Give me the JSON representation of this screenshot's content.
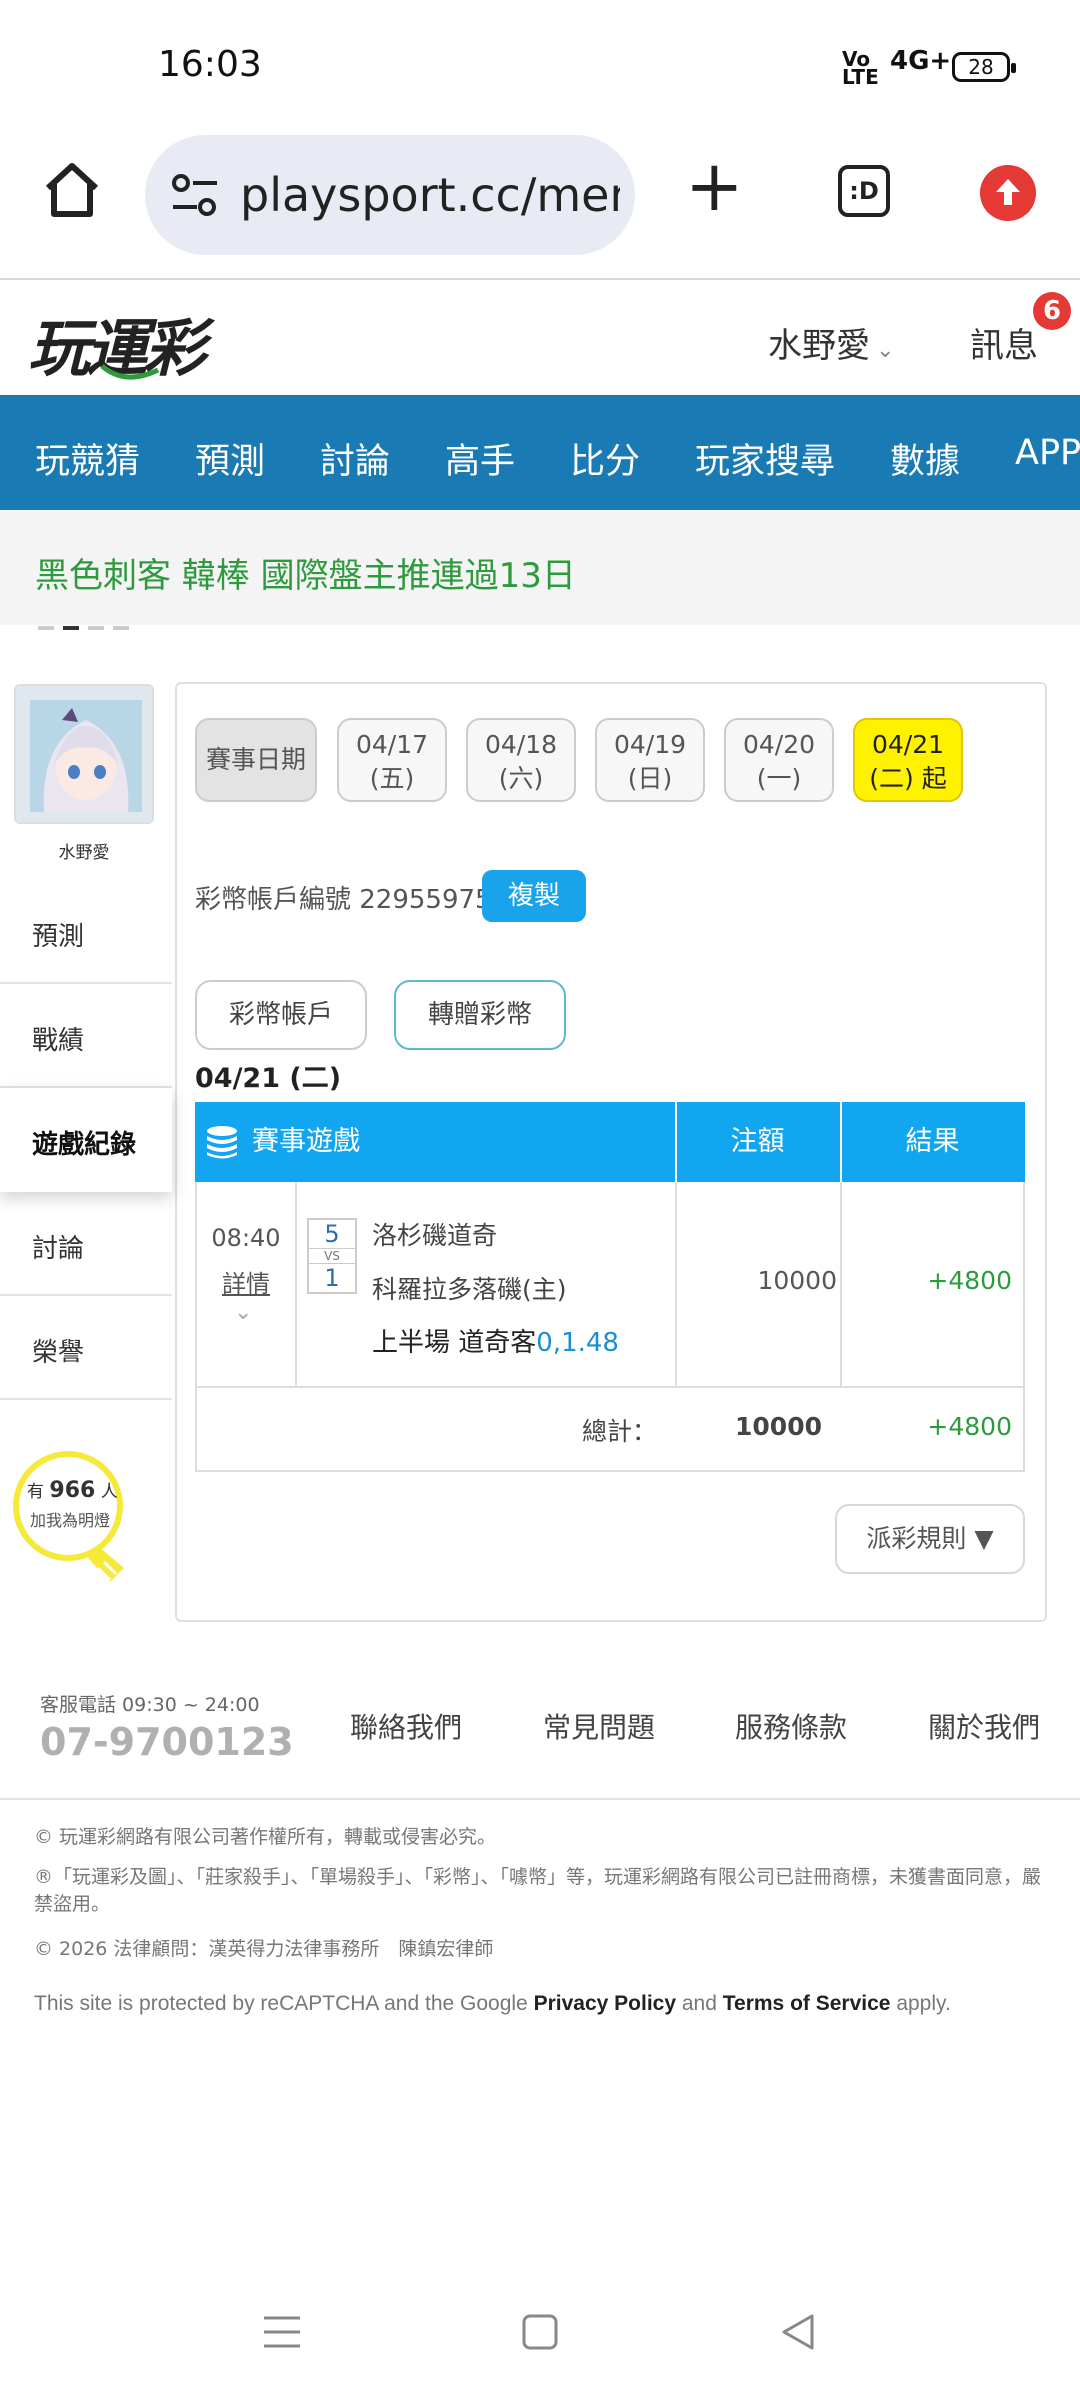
{
  "status_bar": {
    "time": "16:03",
    "network_label": "Vo LTE",
    "signal_label": "4G+",
    "battery": "28"
  },
  "browser": {
    "url": "playsport.cc/men",
    "tab_label": ":D"
  },
  "header": {
    "logo_text": "玩運彩",
    "user_name": "水野愛",
    "messages_label": "訊息",
    "messages_count": "6"
  },
  "nav": {
    "items": [
      "玩競猜",
      "預測",
      "討論",
      "高手",
      "比分",
      "玩家搜尋",
      "數據",
      "APP"
    ]
  },
  "marquee": {
    "text": "黑色刺客 韓棒 國際盤主推連過13日"
  },
  "sidebar": {
    "user_name": "水野愛",
    "items": [
      "預測",
      "戰績",
      "遊戲紀錄",
      "討論",
      "榮譽"
    ],
    "bulb": {
      "prefix": "有",
      "count": "966",
      "suffix": "人",
      "line2": "加我為明燈"
    }
  },
  "dates": {
    "label": "賽事日期",
    "items": [
      {
        "date": "04/17",
        "day": "(五)"
      },
      {
        "date": "04/18",
        "day": "(六)"
      },
      {
        "date": "04/19",
        "day": "(日)"
      },
      {
        "date": "04/20",
        "day": "(一)"
      },
      {
        "date": "04/21",
        "day": "(二) 起"
      }
    ]
  },
  "account": {
    "label": "彩幣帳戶編號 22955975",
    "copy_label": "複製"
  },
  "tabs": [
    "彩幣帳戶",
    "轉贈彩幣"
  ],
  "date_title": "04/21 (二)",
  "table": {
    "headers": {
      "game": "賽事遊戲",
      "amount": "注額",
      "result": "結果"
    },
    "row": {
      "time": "08:40",
      "detail": "詳情",
      "away_no": "5",
      "vs": "VS",
      "home_no": "1",
      "away_team": "洛杉磯道奇",
      "home_team": "科羅拉多落磯(主)",
      "bet_prefix": "上半場 道奇客",
      "bet_odds": "0,1.48",
      "amount": "10000",
      "result": "+4800"
    },
    "total": {
      "label": "總計：",
      "amount": "10000",
      "result": "+4800"
    }
  },
  "rules_button": "派彩規則 ▼",
  "footer": {
    "service_label": "客服電話 09:30 ~ 24:00",
    "phone": "07-9700123",
    "links": [
      "聯絡我們",
      "常見問題",
      "服務條款",
      "關於我們"
    ],
    "copyright": "© 玩運彩網路有限公司著作權所有，轉載或侵害必究。",
    "trademark": "®「玩運彩及圖」、「莊家殺手」、「單場殺手」、「彩幣」、「噱幣」等，玩運彩網路有限公司已註冊商標，未獲書面同意，嚴禁盜用。",
    "lawyer": "© 2026 法律顧問：漢英得力法律事務所　陳鎮宏律師",
    "recaptcha_prefix": "This site is protected by reCAPTCHA and the Google",
    "privacy": "Privacy Policy",
    "and": "and",
    "terms": "Terms of Service",
    "apply": "apply."
  },
  "colors": {
    "nav_blue": "#1a7ab4",
    "table_header": "#13a6f0",
    "selected_date": "#fff200",
    "win_green": "#2e9a3e",
    "badge_red": "#e53935"
  }
}
